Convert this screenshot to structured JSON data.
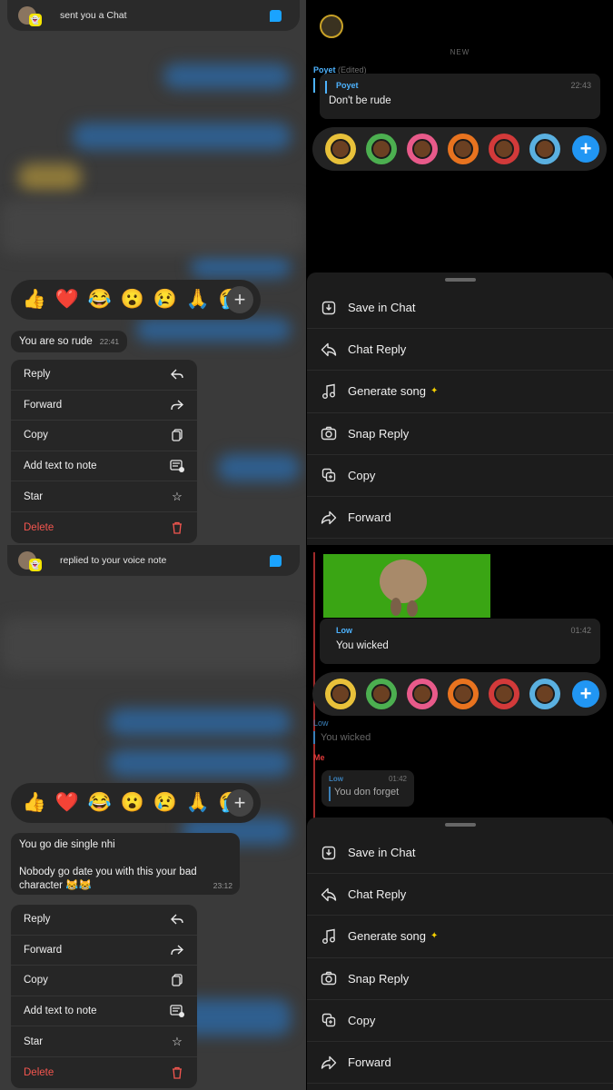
{
  "wa_top": {
    "notification": {
      "text": "sent you a Chat"
    },
    "reactions": [
      "👍",
      "❤️",
      "😂",
      "😮",
      "😢",
      "🙏",
      "😭"
    ],
    "message": {
      "text": "You are so rude",
      "time": "22:41"
    },
    "menu": [
      {
        "label": "Reply",
        "icon": "reply-icon"
      },
      {
        "label": "Forward",
        "icon": "forward-icon"
      },
      {
        "label": "Copy",
        "icon": "copy-icon"
      },
      {
        "label": "Add text to note",
        "icon": "note-icon"
      },
      {
        "label": "Star",
        "icon": "star-icon"
      },
      {
        "label": "Delete",
        "icon": "trash-icon"
      }
    ]
  },
  "wa_bottom": {
    "notification": {
      "text": "replied to your voice note"
    },
    "reactions": [
      "👍",
      "❤️",
      "😂",
      "😮",
      "😢",
      "🙏",
      "😭"
    ],
    "message": {
      "line1": "You go die single nhi",
      "line2": "Nobody go date you with this your bad",
      "line3": "character 😹😹",
      "time": "23:12"
    },
    "menu": [
      {
        "label": "Reply",
        "icon": "reply-icon"
      },
      {
        "label": "Forward",
        "icon": "forward-icon"
      },
      {
        "label": "Copy",
        "icon": "copy-icon"
      },
      {
        "label": "Add text to note",
        "icon": "note-icon"
      },
      {
        "label": "Star",
        "icon": "star-icon"
      },
      {
        "label": "Delete",
        "icon": "trash-icon"
      }
    ]
  },
  "snap_top": {
    "new_label": "NEW",
    "sender": "Poyet",
    "edited": "(Edited)",
    "card": {
      "name": "Poyet",
      "time": "22:43",
      "text": "Don't be rude"
    },
    "sheet": [
      {
        "label": "Save in Chat",
        "icon": "save-icon"
      },
      {
        "label": "Chat Reply",
        "icon": "reply-icon"
      },
      {
        "label": "Generate song",
        "icon": "music-icon",
        "sparkle": "✦"
      },
      {
        "label": "Snap Reply",
        "icon": "camera-icon"
      },
      {
        "label": "Copy",
        "icon": "copy-icon"
      },
      {
        "label": "Forward",
        "icon": "forward-icon"
      }
    ]
  },
  "snap_bottom": {
    "card": {
      "name": "Low",
      "time": "01:42",
      "text": "You wicked"
    },
    "quoted_name": "Low",
    "quoted_text": "You wicked",
    "me_label": "Me",
    "reply_card": {
      "name": "Low",
      "time": "01:42",
      "text": "You don forget"
    },
    "sheet": [
      {
        "label": "Save in Chat",
        "icon": "save-icon"
      },
      {
        "label": "Chat Reply",
        "icon": "reply-icon"
      },
      {
        "label": "Generate song",
        "icon": "music-icon",
        "sparkle": "✦"
      },
      {
        "label": "Snap Reply",
        "icon": "camera-icon"
      },
      {
        "label": "Copy",
        "icon": "copy-icon"
      },
      {
        "label": "Forward",
        "icon": "forward-icon"
      }
    ]
  },
  "colors": {
    "snap_blue": "#4db3ff",
    "delete_red": "#f4564f",
    "add_blue": "#2196f3",
    "green_screen": "#3aa514"
  }
}
